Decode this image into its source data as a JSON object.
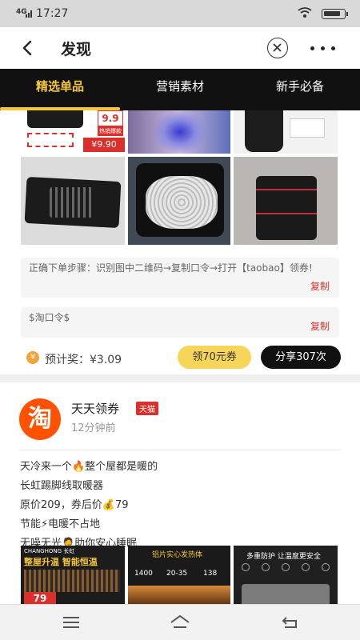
{
  "status_bar": {
    "signal": "4G",
    "time": "17:27"
  },
  "header": {
    "title": "发现"
  },
  "tabs": [
    {
      "label": "精选单品"
    },
    {
      "label": "营销素材"
    },
    {
      "label": "新手必备"
    }
  ],
  "post1": {
    "promo": {
      "price_tag": "9.9",
      "promo_text": "热销爆款",
      "price": "¥9.90"
    },
    "steps_text": "正确下单步骤：识别图中二维码→复制口令→打开【taobao】领券!",
    "copy_label": "复制",
    "token_text": "$淘口令$",
    "token_copy_label": "复制",
    "reward_text": "预计奖：¥3.09",
    "coupon_button": "领70元券",
    "share_button": "分享307次"
  },
  "post2": {
    "avatar_char": "淘",
    "name": "天天领券",
    "badge": "天猫",
    "time": "12分钟前",
    "lines": [
      "天冷来一个🔥整个屋都是暖的",
      "长虹踢脚线取暖器",
      "原价209，券后价💰79",
      "节能⚡电暖不占地",
      "无噪无光🤦助你安心睡眠"
    ],
    "images": [
      {
        "brand": "CHANGHONG 长虹",
        "caption": "整屋升温 智能恒温",
        "price": "79"
      },
      {
        "caption": "铝片实心发热体",
        "specs": [
          "1400",
          "20-35",
          "138"
        ]
      },
      {
        "caption": "多重防护 让温度更安全"
      }
    ]
  },
  "colors": {
    "accent": "#f5c73b",
    "tab_bg": "#111111",
    "copy_red": "#d9302b",
    "coupon_yellow": "#f5d55a"
  }
}
